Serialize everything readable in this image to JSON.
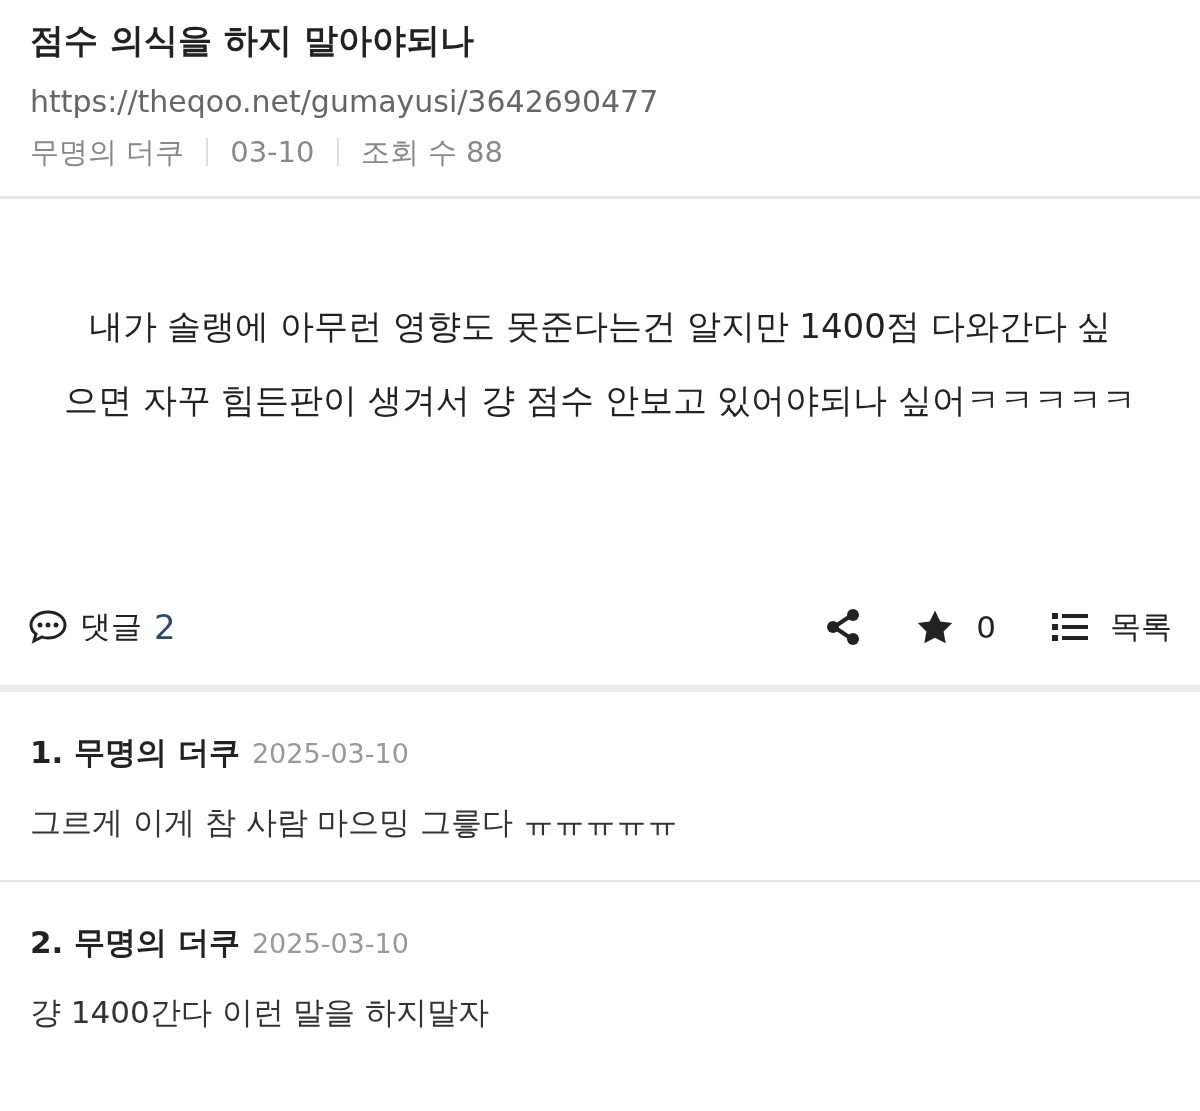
{
  "post": {
    "title": "점수 의식을 하지 말아야되나",
    "url": "https://theqoo.net/gumayusi/3642690477",
    "meta": [
      "무명의 더쿠",
      "03-10",
      "조회 수 88"
    ],
    "body_lines": [
      "내가 솔랭에 아무런 영향도 못준다는건 알지만 1400점 다와간다 싶",
      "으면 자꾸 힘든판이 생겨서 걍 점수 안보고 있어야되나 싶어ㅋㅋㅋㅋㅋ"
    ]
  },
  "actions": {
    "comments_label": "댓글",
    "comments_count": "2",
    "star_count": "0",
    "list_label": "목록"
  },
  "comments": [
    {
      "heading": "1. 무명의 더쿠",
      "date": "2025-03-10",
      "text": "그르게 이게 참 사람 마으밍 그릏다 ㅠㅠㅠㅠㅠ"
    },
    {
      "heading": "2. 무명의 더쿠",
      "date": "2025-03-10",
      "text": "걍 1400간다 이런 말을 하지말자"
    }
  ]
}
